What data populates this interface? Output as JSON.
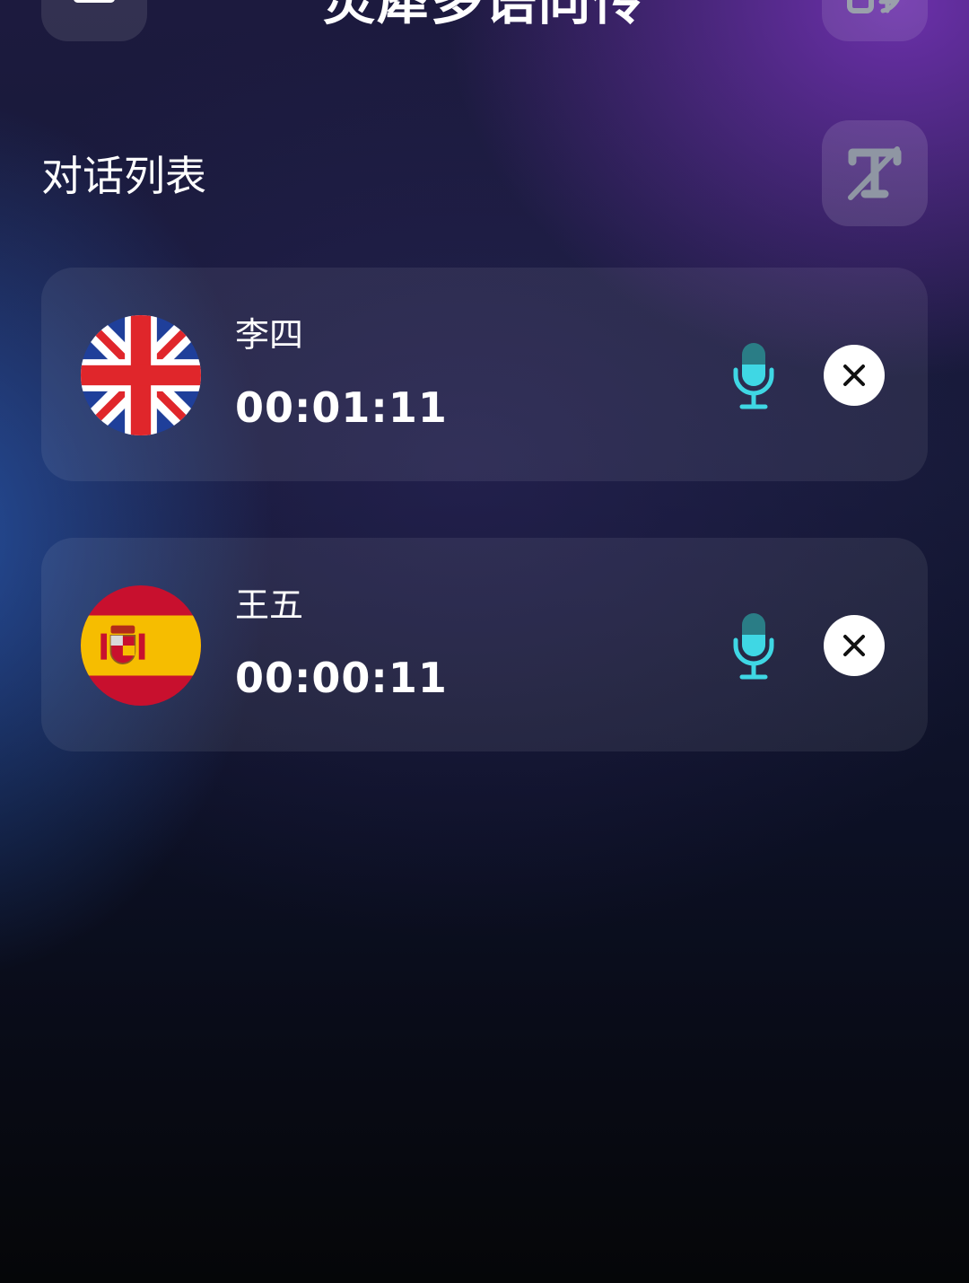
{
  "header": {
    "title": "灵犀多语同传",
    "menu_icon": "menu-icon",
    "translate_icon": "translate-icon"
  },
  "conversation_list": {
    "title": "对话列表",
    "text_toggle_icon": "text-off-icon"
  },
  "conversations": [
    {
      "name": "李四",
      "duration": "00:01:11",
      "flag_icon": "uk-flag-icon",
      "mic_icon": "microphone-icon",
      "close_icon": "close-icon"
    },
    {
      "name": "王五",
      "duration": "00:00:11",
      "flag_icon": "spain-flag-icon",
      "mic_icon": "microphone-icon",
      "close_icon": "close-icon"
    }
  ],
  "colors": {
    "accent": "#3fd7e4",
    "accent_dark": "#2a7d86",
    "uk_blue": "#1f3f9a",
    "uk_red": "#e0262b",
    "es_red": "#c8102e",
    "es_yellow": "#f6bd00"
  }
}
